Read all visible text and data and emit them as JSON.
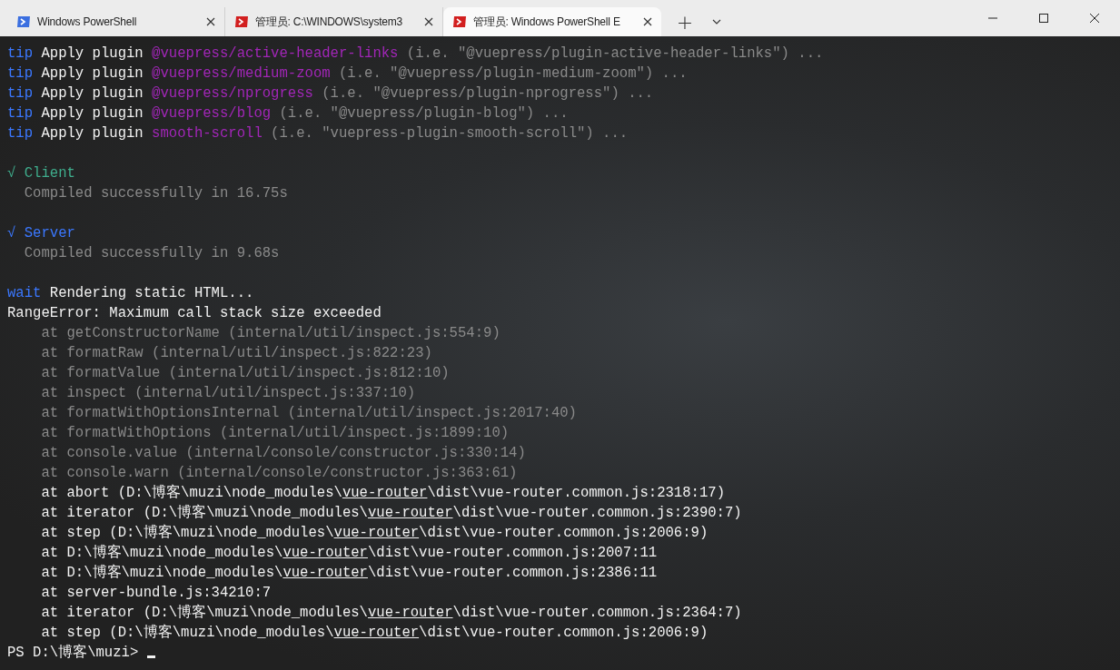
{
  "tabs": [
    {
      "title": "Windows PowerShell",
      "kind": "shell",
      "selected": false
    },
    {
      "title": "管理员:  C:\\WINDOWS\\system3",
      "kind": "admin",
      "selected": false
    },
    {
      "title": "管理员: Windows PowerShell E",
      "kind": "admin",
      "selected": true
    }
  ],
  "new_tab": "+",
  "terminal": {
    "blocks": [
      [
        [
          {
            "kind": "label",
            "text": "tip"
          },
          {
            "kind": "text",
            "text": " Apply plugin "
          },
          {
            "kind": "plugin",
            "text": "@vuepress/active-header-links"
          },
          {
            "kind": "dim",
            "text": " (i.e. \"@vuepress/plugin-active-header-links\") ..."
          }
        ],
        [
          {
            "kind": "label",
            "text": "tip"
          },
          {
            "kind": "text",
            "text": " Apply plugin "
          },
          {
            "kind": "plugin",
            "text": "@vuepress/medium-zoom"
          },
          {
            "kind": "dim",
            "text": " (i.e. \"@vuepress/plugin-medium-zoom\") ..."
          }
        ],
        [
          {
            "kind": "label",
            "text": "tip"
          },
          {
            "kind": "text",
            "text": " Apply plugin "
          },
          {
            "kind": "plugin",
            "text": "@vuepress/nprogress"
          },
          {
            "kind": "dim",
            "text": " (i.e. \"@vuepress/plugin-nprogress\") ..."
          }
        ],
        [
          {
            "kind": "label",
            "text": "tip"
          },
          {
            "kind": "text",
            "text": " Apply plugin "
          },
          {
            "kind": "plugin",
            "text": "@vuepress/blog"
          },
          {
            "kind": "dim",
            "text": " (i.e. \"@vuepress/plugin-blog\") ..."
          }
        ],
        [
          {
            "kind": "label",
            "text": "tip"
          },
          {
            "kind": "text",
            "text": " Apply plugin "
          },
          {
            "kind": "plugin",
            "text": "smooth-scroll"
          },
          {
            "kind": "dim",
            "text": " (i.e. \"vuepress-plugin-smooth-scroll\") ..."
          }
        ]
      ],
      [
        [
          {
            "kind": "ok-client",
            "text": "√ Client"
          }
        ],
        [
          {
            "kind": "dim",
            "text": "  Compiled successfully in 16.75s"
          }
        ]
      ],
      [
        [
          {
            "kind": "label",
            "text": "√ Server"
          }
        ],
        [
          {
            "kind": "dim",
            "text": "  Compiled successfully in 9.68s"
          }
        ]
      ],
      [
        [
          {
            "kind": "label",
            "text": "wait"
          },
          {
            "kind": "text",
            "text": " Rendering static HTML..."
          }
        ],
        [
          {
            "kind": "text",
            "text": "RangeError: Maximum call stack size exceeded"
          }
        ],
        [
          {
            "kind": "dim",
            "text": "    at getConstructorName (internal/util/inspect.js:554:9)"
          }
        ],
        [
          {
            "kind": "dim",
            "text": "    at formatRaw (internal/util/inspect.js:822:23)"
          }
        ],
        [
          {
            "kind": "dim",
            "text": "    at formatValue (internal/util/inspect.js:812:10)"
          }
        ],
        [
          {
            "kind": "dim",
            "text": "    at inspect (internal/util/inspect.js:337:10)"
          }
        ],
        [
          {
            "kind": "dim",
            "text": "    at formatWithOptionsInternal (internal/util/inspect.js:2017:40)"
          }
        ],
        [
          {
            "kind": "dim",
            "text": "    at formatWithOptions (internal/util/inspect.js:1899:10)"
          }
        ],
        [
          {
            "kind": "dim",
            "text": "    at console.value (internal/console/constructor.js:330:14)"
          }
        ],
        [
          {
            "kind": "dim",
            "text": "    at console.warn (internal/console/constructor.js:363:61)"
          }
        ],
        [
          {
            "kind": "text",
            "text": "    at abort (D:\\博客\\muzi\\node_modules\\"
          },
          {
            "kind": "path",
            "text": "vue-router"
          },
          {
            "kind": "text",
            "text": "\\dist\\vue-router.common.js:2318:17)"
          }
        ],
        [
          {
            "kind": "text",
            "text": "    at iterator (D:\\博客\\muzi\\node_modules\\"
          },
          {
            "kind": "path",
            "text": "vue-router"
          },
          {
            "kind": "text",
            "text": "\\dist\\vue-router.common.js:2390:7)"
          }
        ],
        [
          {
            "kind": "text",
            "text": "    at step (D:\\博客\\muzi\\node_modules\\"
          },
          {
            "kind": "path",
            "text": "vue-router"
          },
          {
            "kind": "text",
            "text": "\\dist\\vue-router.common.js:2006:9)"
          }
        ],
        [
          {
            "kind": "text",
            "text": "    at D:\\博客\\muzi\\node_modules\\"
          },
          {
            "kind": "path",
            "text": "vue-router"
          },
          {
            "kind": "text",
            "text": "\\dist\\vue-router.common.js:2007:11"
          }
        ],
        [
          {
            "kind": "text",
            "text": "    at D:\\博客\\muzi\\node_modules\\"
          },
          {
            "kind": "path",
            "text": "vue-router"
          },
          {
            "kind": "text",
            "text": "\\dist\\vue-router.common.js:2386:11"
          }
        ],
        [
          {
            "kind": "text",
            "text": "    at server-bundle.js:34210:7"
          }
        ],
        [
          {
            "kind": "text",
            "text": "    at iterator (D:\\博客\\muzi\\node_modules\\"
          },
          {
            "kind": "path",
            "text": "vue-router"
          },
          {
            "kind": "text",
            "text": "\\dist\\vue-router.common.js:2364:7)"
          }
        ],
        [
          {
            "kind": "text",
            "text": "    at step (D:\\博客\\muzi\\node_modules\\"
          },
          {
            "kind": "path",
            "text": "vue-router"
          },
          {
            "kind": "text",
            "text": "\\dist\\vue-router.common.js:2006:9)"
          }
        ]
      ]
    ],
    "prompt": "PS D:\\博客\\muzi> "
  }
}
